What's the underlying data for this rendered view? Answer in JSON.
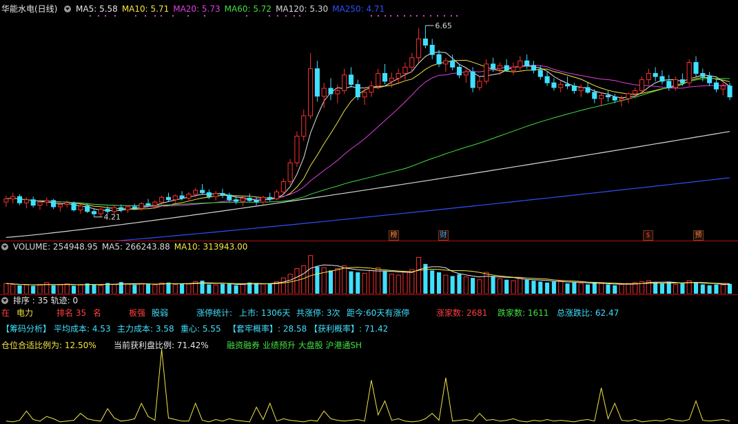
{
  "header": {
    "title": "华能水电(日线)",
    "ma_items": [
      {
        "label": "MA5: 5.58",
        "color": "#e8e8e8"
      },
      {
        "label": "MA10: 5.71",
        "color": "#f5e642"
      },
      {
        "label": "MA20: 5.73",
        "color": "#e040e0"
      },
      {
        "label": "MA60: 5.72",
        "color": "#40e040"
      },
      {
        "label": "MA120: 5.30",
        "color": "#d8d8d8"
      },
      {
        "label": "MA250: 4.71",
        "color": "#3050ff"
      }
    ]
  },
  "volume_header": {
    "items": [
      {
        "label": "VOLUME: 254948.95",
        "color": "#d8d8d8"
      },
      {
        "label": "MA5: 266243.88",
        "color": "#d8d8d8"
      },
      {
        "label": "MA10: 313943.00",
        "color": "#f5e642"
      }
    ]
  },
  "indicator_header": {
    "label": "排序 : 35 轨迹: 0"
  },
  "info": {
    "row1": [
      {
        "text": "在",
        "color": "#ff4040"
      },
      {
        "text": "电力",
        "color": "#f5e642"
      },
      {
        "text": "排名 35",
        "color": "#ff4040"
      },
      {
        "text": "名",
        "color": "#ff4040"
      },
      {
        "text": "板强",
        "color": "#ff4040"
      },
      {
        "text": "股弱",
        "color": "#40e0ff"
      },
      {
        "text": "涨停统计:",
        "color": "#40e0ff"
      },
      {
        "text": "上市: 1306天",
        "color": "#40e0ff"
      },
      {
        "text": "共涨停: 3次",
        "color": "#40e0ff"
      },
      {
        "text": "距今:60天有涨停",
        "color": "#40e0ff"
      },
      {
        "text": "涨家数: 2681",
        "color": "#ff4040"
      },
      {
        "text": "跌家数: 1611",
        "color": "#40e040"
      },
      {
        "text": "总涨跌比: 62.47",
        "color": "#40e0ff"
      }
    ],
    "row2": [
      {
        "text": "【筹码分析】",
        "color": "#40e0ff"
      },
      {
        "text": "平均成本: 4.53",
        "color": "#40e0ff"
      },
      {
        "text": "主力成本: 3.58",
        "color": "#40e0ff"
      },
      {
        "text": "重心: 5.55",
        "color": "#40e0ff"
      },
      {
        "text": "【套牢概率】: 28.58",
        "color": "#40e0ff"
      },
      {
        "text": "【获利概率】: 71.42",
        "color": "#40e0ff"
      }
    ],
    "row3": [
      {
        "text": "仓位合适比例为: 12.50%",
        "color": "#f5e642"
      },
      {
        "text": "当前获利盘比例: 71.42%",
        "color": "#e8e8e8"
      },
      {
        "text": "融资融券 业绩预升 大盘股 沪港通SH",
        "color": "#40e040"
      }
    ]
  },
  "chart_data": {
    "type": "candlestick",
    "price_annotations": [
      {
        "label": "6.65",
        "value": 6.65
      },
      {
        "label": "4.21",
        "value": 4.21
      }
    ],
    "event_markers": [
      "榜",
      "财",
      "$",
      "预"
    ],
    "ohlc": [
      [
        4.4,
        4.48,
        4.34,
        4.44
      ],
      [
        4.44,
        4.52,
        4.38,
        4.47
      ],
      [
        4.47,
        4.5,
        4.36,
        4.39
      ],
      [
        4.39,
        4.46,
        4.32,
        4.43
      ],
      [
        4.43,
        4.47,
        4.33,
        4.36
      ],
      [
        4.36,
        4.43,
        4.3,
        4.4
      ],
      [
        4.4,
        4.46,
        4.35,
        4.42
      ],
      [
        4.42,
        4.44,
        4.31,
        4.34
      ],
      [
        4.34,
        4.4,
        4.28,
        4.37
      ],
      [
        4.37,
        4.42,
        4.33,
        4.39
      ],
      [
        4.39,
        4.41,
        4.28,
        4.3
      ],
      [
        4.3,
        4.37,
        4.25,
        4.35
      ],
      [
        4.35,
        4.38,
        4.26,
        4.28
      ],
      [
        4.28,
        4.31,
        4.21,
        4.25
      ],
      [
        4.25,
        4.33,
        4.21,
        4.31
      ],
      [
        4.31,
        4.35,
        4.25,
        4.28
      ],
      [
        4.28,
        4.36,
        4.24,
        4.33
      ],
      [
        4.33,
        4.37,
        4.27,
        4.3
      ],
      [
        4.3,
        4.36,
        4.26,
        4.34
      ],
      [
        4.34,
        4.38,
        4.3,
        4.32
      ],
      [
        4.32,
        4.4,
        4.29,
        4.38
      ],
      [
        4.38,
        4.44,
        4.34,
        4.36
      ],
      [
        4.36,
        4.42,
        4.31,
        4.4
      ],
      [
        4.4,
        4.48,
        4.37,
        4.46
      ],
      [
        4.46,
        4.52,
        4.4,
        4.43
      ],
      [
        4.43,
        4.5,
        4.39,
        4.48
      ],
      [
        4.48,
        4.54,
        4.42,
        4.45
      ],
      [
        4.45,
        4.53,
        4.41,
        4.5
      ],
      [
        4.5,
        4.58,
        4.46,
        4.55
      ],
      [
        4.55,
        4.63,
        4.49,
        4.52
      ],
      [
        4.52,
        4.56,
        4.44,
        4.47
      ],
      [
        4.47,
        4.54,
        4.42,
        4.51
      ],
      [
        4.51,
        4.57,
        4.45,
        4.49
      ],
      [
        4.49,
        4.52,
        4.4,
        4.43
      ],
      [
        4.43,
        4.48,
        4.37,
        4.41
      ],
      [
        4.41,
        4.47,
        4.35,
        4.45
      ],
      [
        4.45,
        4.51,
        4.4,
        4.42
      ],
      [
        4.42,
        4.46,
        4.36,
        4.4
      ],
      [
        4.4,
        4.48,
        4.37,
        4.46
      ],
      [
        4.46,
        4.52,
        4.41,
        4.44
      ],
      [
        4.44,
        4.56,
        4.42,
        4.53
      ],
      [
        4.53,
        4.7,
        4.5,
        4.66
      ],
      [
        4.66,
        4.95,
        4.62,
        4.9
      ],
      [
        4.9,
        5.3,
        4.85,
        5.24
      ],
      [
        5.24,
        5.58,
        5.18,
        5.5
      ],
      [
        5.5,
        6.3,
        5.46,
        6.1
      ],
      [
        6.1,
        6.2,
        5.68,
        5.75
      ],
      [
        5.75,
        5.92,
        5.6,
        5.85
      ],
      [
        5.85,
        5.98,
        5.7,
        5.78
      ],
      [
        5.78,
        5.9,
        5.66,
        5.82
      ],
      [
        5.82,
        6.1,
        5.78,
        6.02
      ],
      [
        6.02,
        6.12,
        5.86,
        5.9
      ],
      [
        5.9,
        5.96,
        5.7,
        5.74
      ],
      [
        5.74,
        5.86,
        5.64,
        5.8
      ],
      [
        5.8,
        5.94,
        5.74,
        5.88
      ],
      [
        5.88,
        6.1,
        5.84,
        6.04
      ],
      [
        6.04,
        6.16,
        5.9,
        5.94
      ],
      [
        5.94,
        6.05,
        5.86,
        5.98
      ],
      [
        5.98,
        6.1,
        5.9,
        6.04
      ],
      [
        6.04,
        6.18,
        5.96,
        6.12
      ],
      [
        6.12,
        6.3,
        6.06,
        6.24
      ],
      [
        6.24,
        6.62,
        6.18,
        6.48
      ],
      [
        6.48,
        6.65,
        6.36,
        6.4
      ],
      [
        6.4,
        6.48,
        6.22,
        6.28
      ],
      [
        6.28,
        6.34,
        6.12,
        6.16
      ],
      [
        6.16,
        6.24,
        6.06,
        6.2
      ],
      [
        6.2,
        6.28,
        6.08,
        6.12
      ],
      [
        6.12,
        6.16,
        5.98,
        6.02
      ],
      [
        6.02,
        6.1,
        5.92,
        6.06
      ],
      [
        6.06,
        6.12,
        5.8,
        5.86
      ],
      [
        5.86,
        6.0,
        5.82,
        5.94
      ],
      [
        5.94,
        6.22,
        5.9,
        6.16
      ],
      [
        6.16,
        6.24,
        6.06,
        6.1
      ],
      [
        6.1,
        6.18,
        6.02,
        6.14
      ],
      [
        6.14,
        6.22,
        6.06,
        6.08
      ],
      [
        6.08,
        6.18,
        6.02,
        6.12
      ],
      [
        6.12,
        6.26,
        6.08,
        6.2
      ],
      [
        6.2,
        6.28,
        6.1,
        6.14
      ],
      [
        6.14,
        6.2,
        6.04,
        6.08
      ],
      [
        6.08,
        6.14,
        5.96,
        6.0
      ],
      [
        6.0,
        6.06,
        5.88,
        5.92
      ],
      [
        5.92,
        5.98,
        5.82,
        5.86
      ],
      [
        5.86,
        5.94,
        5.8,
        5.9
      ],
      [
        5.9,
        6.0,
        5.84,
        5.88
      ],
      [
        5.88,
        5.92,
        5.78,
        5.82
      ],
      [
        5.82,
        5.9,
        5.74,
        5.86
      ],
      [
        5.86,
        5.92,
        5.78,
        5.8
      ],
      [
        5.8,
        5.84,
        5.66,
        5.72
      ],
      [
        5.72,
        5.8,
        5.62,
        5.76
      ],
      [
        5.76,
        5.82,
        5.68,
        5.74
      ],
      [
        5.74,
        5.78,
        5.66,
        5.7
      ],
      [
        5.7,
        5.76,
        5.62,
        5.72
      ],
      [
        5.72,
        5.8,
        5.66,
        5.78
      ],
      [
        5.78,
        5.86,
        5.72,
        5.82
      ],
      [
        5.82,
        6.0,
        5.78,
        5.96
      ],
      [
        5.96,
        6.1,
        5.9,
        6.04
      ],
      [
        6.04,
        6.12,
        5.94,
        6.0
      ],
      [
        6.0,
        6.08,
        5.9,
        5.94
      ],
      [
        5.94,
        6.02,
        5.82,
        5.86
      ],
      [
        5.86,
        6.0,
        5.82,
        5.96
      ],
      [
        5.96,
        6.04,
        5.88,
        5.92
      ],
      [
        5.92,
        6.22,
        5.88,
        6.18
      ],
      [
        6.18,
        6.26,
        6.0,
        6.04
      ],
      [
        6.04,
        6.1,
        5.94,
        6.0
      ],
      [
        6.0,
        6.06,
        5.88,
        5.92
      ],
      [
        5.92,
        5.98,
        5.8,
        5.84
      ],
      [
        5.84,
        5.92,
        5.76,
        5.88
      ],
      [
        5.88,
        5.92,
        5.7,
        5.74
      ]
    ],
    "volume": [
      2.2,
      2.0,
      1.8,
      1.9,
      1.7,
      2.0,
      2.4,
      1.8,
      1.9,
      2.1,
      1.7,
      2.0,
      2.2,
      1.9,
      1.8,
      2.3,
      2.0,
      2.5,
      2.1,
      1.9,
      2.2,
      2.0,
      1.9,
      2.3,
      2.4,
      2.0,
      2.2,
      2.1,
      2.6,
      2.8,
      2.0,
      1.9,
      2.1,
      2.2,
      1.8,
      2.0,
      2.4,
      2.3,
      2.1,
      2.2,
      2.6,
      3.4,
      4.2,
      5.4,
      6.0,
      8.2,
      5.8,
      5.6,
      5.0,
      5.4,
      6.0,
      4.8,
      4.6,
      4.4,
      5.0,
      5.6,
      4.8,
      4.2,
      4.0,
      4.6,
      5.2,
      7.8,
      6.4,
      5.0,
      4.6,
      4.0,
      3.8,
      4.2,
      3.6,
      3.4,
      3.0,
      4.6,
      3.8,
      3.2,
      3.0,
      2.8,
      3.4,
      3.0,
      2.8,
      2.6,
      2.4,
      2.6,
      2.8,
      2.2,
      2.4,
      2.2,
      2.0,
      2.4,
      2.2,
      2.0,
      1.8,
      2.0,
      2.2,
      2.4,
      2.6,
      2.8,
      2.4,
      2.2,
      2.6,
      2.0,
      2.2,
      2.8,
      2.4,
      2.0,
      1.8,
      2.0,
      1.9,
      2.1
    ],
    "indicator": [
      0.02,
      0.01,
      0.03,
      0.15,
      0.04,
      0.02,
      0.08,
      0.05,
      0.01,
      0.02,
      0.03,
      0.12,
      0.05,
      0.03,
      0.02,
      0.18,
      0.06,
      0.02,
      0.03,
      0.05,
      0.25,
      0.08,
      0.03,
      0.95,
      0.06,
      0.04,
      0.02,
      0.02,
      0.25,
      0.03,
      0.01,
      0.04,
      0.02,
      0.05,
      0.03,
      0.02,
      0.01,
      0.2,
      0.04,
      0.25,
      0.02,
      0.05,
      0.03,
      0.02,
      0.01,
      0.03,
      0.02,
      0.15,
      0.05,
      0.03,
      0.02,
      0.03,
      0.04,
      0.02,
      0.55,
      0.1,
      0.28,
      0.03,
      0.05,
      0.02,
      0.01,
      0.02,
      0.05,
      0.12,
      0.03,
      0.58,
      0.02,
      0.03,
      0.04,
      0.02,
      0.12,
      0.03,
      0.04,
      0.02,
      0.03,
      0.05,
      0.02,
      0.01,
      0.03,
      0.02,
      0.04,
      0.02,
      0.03,
      0.02,
      0.01,
      0.03,
      0.04,
      0.02,
      0.45,
      0.05,
      0.25,
      0.03,
      0.02,
      0.04,
      0.01,
      0.02,
      0.03,
      0.02,
      0.05,
      0.03,
      0.02,
      0.04,
      0.28,
      0.03,
      0.02,
      0.03,
      0.04,
      0.02
    ],
    "ylim": [
      3.9,
      6.8
    ],
    "grid": false
  }
}
